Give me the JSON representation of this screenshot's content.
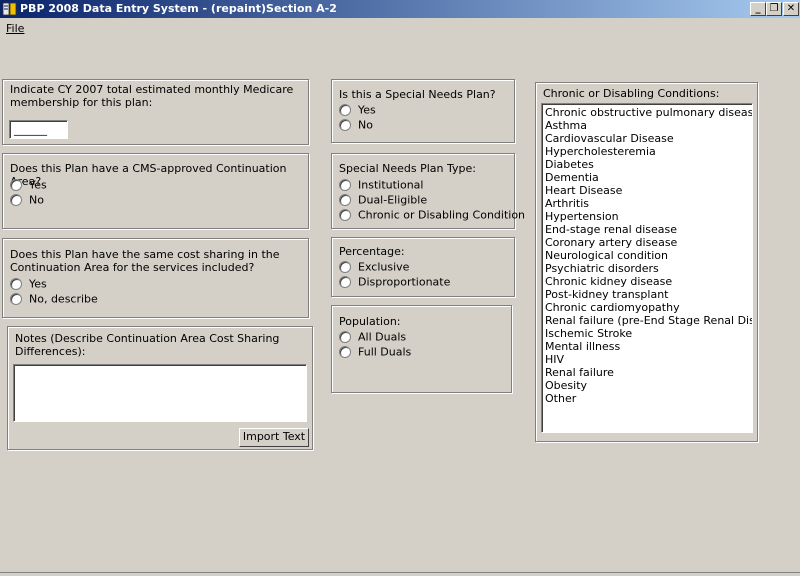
{
  "window": {
    "title": "PBP 2008 Data Entry System - (repaint)Section A-2",
    "controls": {
      "minimize": "_",
      "restore": "❐",
      "close": "✕"
    }
  },
  "menu": {
    "file": "File"
  },
  "membership": {
    "label": "Indicate CY 2007 total estimated monthly Medicare membership for this plan:",
    "value": "______"
  },
  "continuation_area": {
    "question": "Does this Plan have a CMS-approved Continuation Area?",
    "options": [
      "Yes",
      "No"
    ]
  },
  "cost_sharing": {
    "question": "Does this Plan have the same cost sharing in the Continuation Area for the services included?",
    "options": [
      "Yes",
      "No, describe"
    ]
  },
  "notes": {
    "label": "Notes (Describe Continuation Area Cost Sharing Differences):",
    "value": "",
    "import_button": "Import Text"
  },
  "special_needs": {
    "question": "Is this a Special Needs Plan?",
    "options": [
      "Yes",
      "No"
    ]
  },
  "snp_type": {
    "label": "Special Needs Plan Type:",
    "options": [
      "Institutional",
      "Dual-Eligible",
      "Chronic or Disabling Condition"
    ]
  },
  "percentage": {
    "label": "Percentage:",
    "options": [
      "Exclusive",
      "Disproportionate"
    ]
  },
  "population": {
    "label": "Population:",
    "options": [
      "All Duals",
      "Full Duals"
    ]
  },
  "chronic": {
    "label": "Chronic or Disabling Conditions:",
    "items": [
      "Chronic obstructive pulmonary disease",
      "Asthma",
      "Cardiovascular Disease",
      "Hypercholesteremia",
      "Diabetes",
      "Dementia",
      "Heart Disease",
      "Arthritis",
      "Hypertension",
      "End-stage renal disease",
      "Coronary artery disease",
      "Neurological condition",
      "Psychiatric disorders",
      "Chronic kidney disease",
      "Post-kidney transplant",
      "Chronic cardiomyopathy",
      "Renal failure (pre-End Stage Renal Disease)",
      "Ischemic Stroke",
      "Mental illness",
      "HIV",
      "Renal failure",
      "Obesity",
      "Other"
    ]
  }
}
